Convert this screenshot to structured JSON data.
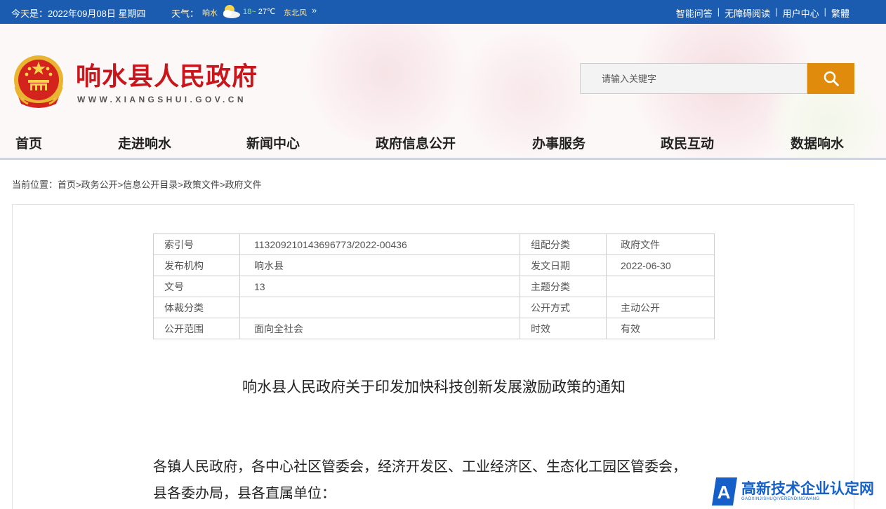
{
  "topbar": {
    "date": "今天是：2022年09月08日 星期四",
    "weather_label": "天气：",
    "city": "响水",
    "temp_low": "18",
    "temp_sep": "~",
    "temp_high": "27℃",
    "wind": "东北风",
    "more": "»",
    "links": [
      "智能问答",
      "无障碍阅读",
      "用户中心",
      "繁體"
    ],
    "separator": "|"
  },
  "header": {
    "site_title": "响水县人民政府",
    "site_domain": "WWW.XIANGSHUI.GOV.CN",
    "search_placeholder": "请输入关键字"
  },
  "nav": [
    "首页",
    "走进响水",
    "新闻中心",
    "政府信息公开",
    "办事服务",
    "政民互动",
    "数据响水"
  ],
  "breadcrumb": {
    "label": "当前位置：",
    "items": [
      "首页",
      "政务公开",
      "信息公开目录",
      "政策文件",
      "政府文件"
    ],
    "sep": ">"
  },
  "meta_table": [
    [
      "索引号",
      "113209210143696773/2022-00436",
      "组配分类",
      "政府文件"
    ],
    [
      "发布机构",
      "响水县",
      "发文日期",
      "2022-06-30"
    ],
    [
      "文号",
      "13",
      "主题分类",
      ""
    ],
    [
      "体裁分类",
      "",
      "公开方式",
      "主动公开"
    ],
    [
      "公开范围",
      "面向全社会",
      "时效",
      "有效"
    ]
  ],
  "document": {
    "title": "响水县人民政府关于印发加快科技创新发展激励政策的通知",
    "body_line1": "各镇人民政府，各中心社区管委会，经济开发区、工业经济区、生态化工园区管委会，",
    "body_line2": "县各委办局，县各直属单位："
  },
  "watermark": {
    "logo_letter": "A",
    "text_cn": "高新技术企业认定网",
    "text_en": "GAOXINJISHUQIYERENDINGWANG"
  },
  "colors": {
    "topbar_bg": "#1b5cb0",
    "title_red": "#c8161d",
    "search_button": "#e08b0b",
    "watermark_blue": "#1560c8"
  }
}
